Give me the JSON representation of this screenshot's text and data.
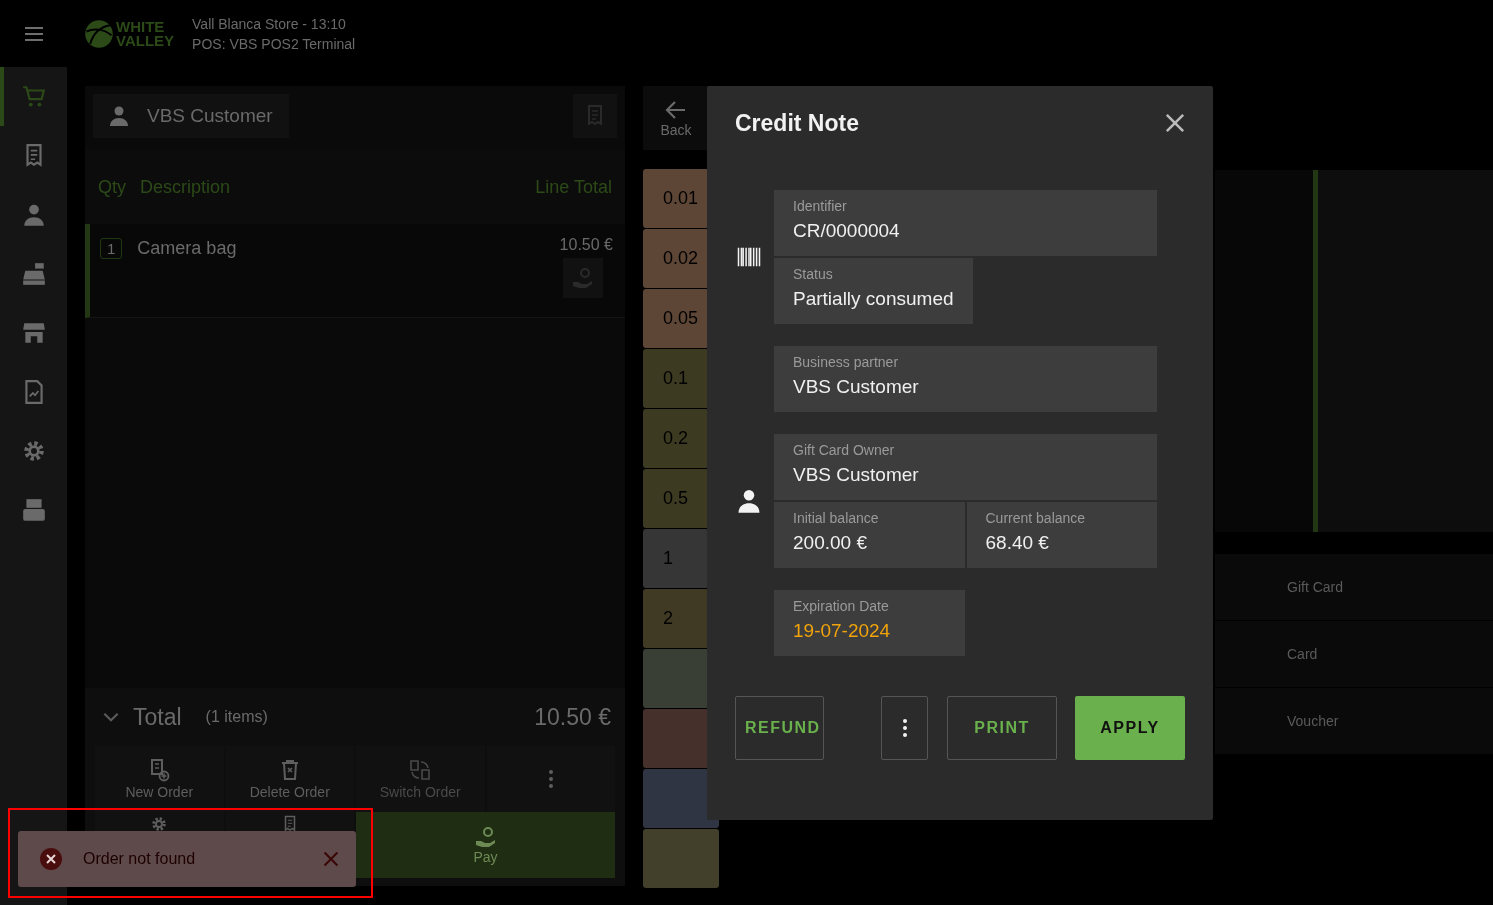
{
  "header": {
    "logo_lines": [
      "WHITE",
      "VALLEY"
    ],
    "store_line": "Vall Blanca Store - 13:10",
    "terminal_line": "POS: VBS POS2 Terminal"
  },
  "sidebar": {
    "items": [
      {
        "kind": "cart",
        "selected": true
      },
      {
        "kind": "receipt",
        "selected": false
      },
      {
        "kind": "person",
        "selected": false
      },
      {
        "kind": "register",
        "selected": false
      },
      {
        "kind": "store",
        "selected": false
      },
      {
        "kind": "report",
        "selected": false
      },
      {
        "kind": "gear",
        "selected": false
      },
      {
        "kind": "drawer",
        "selected": false
      }
    ]
  },
  "order": {
    "customer": "VBS Customer",
    "columns": [
      "Qty",
      "Description",
      "Line Total"
    ],
    "lines": [
      {
        "qty": "1",
        "description": "Camera bag",
        "total": "10.50 €",
        "selected": true
      }
    ],
    "total": {
      "label": "Total",
      "count": "(1 items)",
      "amount": "10.50 €"
    },
    "actions": [
      {
        "kind": "new",
        "label": "New Order",
        "disabled": false
      },
      {
        "kind": "delete",
        "label": "Delete Order",
        "disabled": false
      },
      {
        "kind": "switch",
        "label": "Switch Order",
        "disabled": true
      },
      {
        "kind": "more",
        "disabled": false
      }
    ],
    "actions_row2": [
      {
        "kind": "gear"
      },
      {
        "kind": "receipt"
      }
    ],
    "pay": {
      "label": "Pay"
    }
  },
  "back": {
    "label": "Back"
  },
  "cash": [
    {
      "kind": "coin",
      "label": "0.01",
      "color": "#5e4636"
    },
    {
      "kind": "coin",
      "label": "0.02",
      "color": "#5e4636"
    },
    {
      "kind": "coin",
      "label": "0.05",
      "color": "#5e4636"
    },
    {
      "kind": "coin",
      "label": "0.1",
      "color": "#3d3a22"
    },
    {
      "kind": "coin",
      "label": "0.2",
      "color": "#3d3a22"
    },
    {
      "kind": "coin",
      "label": "0.5",
      "color": "#3d3a22"
    },
    {
      "kind": "coin",
      "label": "1",
      "color": "#363636"
    },
    {
      "kind": "coin",
      "label": "2",
      "color": "#403a24"
    },
    {
      "kind": "note",
      "color": "#3a3f36"
    },
    {
      "kind": "note",
      "color": "#45302c"
    },
    {
      "kind": "note",
      "color": "#2f3542"
    },
    {
      "kind": "note",
      "color": "#423f2a"
    }
  ],
  "payment_methods": [
    "Gift Card",
    "Card",
    "Voucher"
  ],
  "dialog": {
    "title": "Credit Note",
    "sections": [
      {
        "kind": "barcode",
        "lines": [
          [
            {
              "label": "Identifier",
              "value": "CR/0000004",
              "wide": true
            }
          ],
          [
            {
              "label": "Status",
              "value": "Partially consumed",
              "wide": false
            }
          ]
        ]
      },
      {
        "lines": [
          [
            {
              "label": "Business partner",
              "value": "VBS Customer",
              "wide": true
            }
          ]
        ]
      },
      {
        "kind": "person",
        "lines": [
          [
            {
              "label": "Gift Card Owner",
              "value": "VBS Customer",
              "wide": true
            }
          ],
          [
            {
              "label": "Initial balance",
              "value": "200.00 €",
              "wide": false
            },
            {
              "label": "Current balance",
              "value": "68.40 €",
              "wide": false
            }
          ]
        ]
      },
      {
        "lines": [
          [
            {
              "label": "Expiration Date",
              "value": "19-07-2024",
              "wide": false,
              "warning": true
            }
          ]
        ]
      }
    ],
    "buttons": [
      {
        "kind": "outline",
        "label": "REFUND"
      },
      {
        "kind": "more"
      },
      {
        "kind": "outline",
        "label": "PRINT"
      },
      {
        "kind": "filled",
        "label": "APPLY"
      }
    ]
  },
  "toast": {
    "kind": "error",
    "message": "Order not found",
    "highlighted": true
  }
}
